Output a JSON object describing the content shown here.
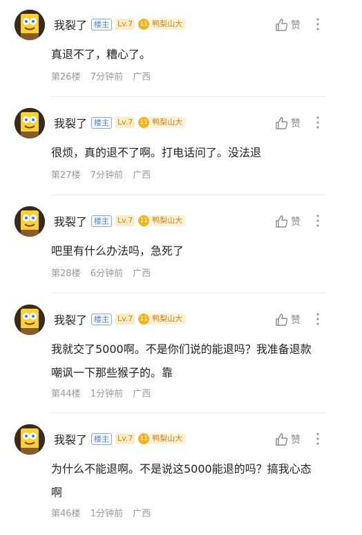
{
  "comments": [
    {
      "username": "我裂了",
      "op_badge": "楼主",
      "level": "Lv.7",
      "medal": "11",
      "fan_badge": "鸭梨山大",
      "like_label": "赞",
      "lines": [
        "真退不了，糟心了。"
      ],
      "floor": "第26楼",
      "time": "7分钟前",
      "location": "广西"
    },
    {
      "username": "我裂了",
      "op_badge": "楼主",
      "level": "Lv.7",
      "medal": "11",
      "fan_badge": "鸭梨山大",
      "like_label": "赞",
      "lines": [
        "很烦，真的退不了啊。打电话问了。没法退"
      ],
      "floor": "第27楼",
      "time": "7分钟前",
      "location": "广西"
    },
    {
      "username": "我裂了",
      "op_badge": "楼主",
      "level": "Lv.7",
      "medal": "11",
      "fan_badge": "鸭梨山大",
      "like_label": "赞",
      "lines": [
        "吧里有什么办法吗，急死了"
      ],
      "floor": "第28楼",
      "time": "6分钟前",
      "location": "广西"
    },
    {
      "username": "我裂了",
      "op_badge": "楼主",
      "level": "Lv.7",
      "medal": "11",
      "fan_badge": "鸭梨山大",
      "like_label": "赞",
      "lines": [
        "我就交了5000啊。不是你们说的能退吗？我准备退款",
        "嘲讽一下那些猴子的。靠"
      ],
      "floor": "第44楼",
      "time": "1分钟前",
      "location": "广西"
    },
    {
      "username": "我裂了",
      "op_badge": "楼主",
      "level": "Lv.7",
      "medal": "11",
      "fan_badge": "鸭梨山大",
      "like_label": "赞",
      "lines": [
        "为什么不能退啊。不是说这5000能退的吗？搞我心态",
        "啊"
      ],
      "floor": "第46楼",
      "time": "1分钟前",
      "location": "广西"
    }
  ]
}
